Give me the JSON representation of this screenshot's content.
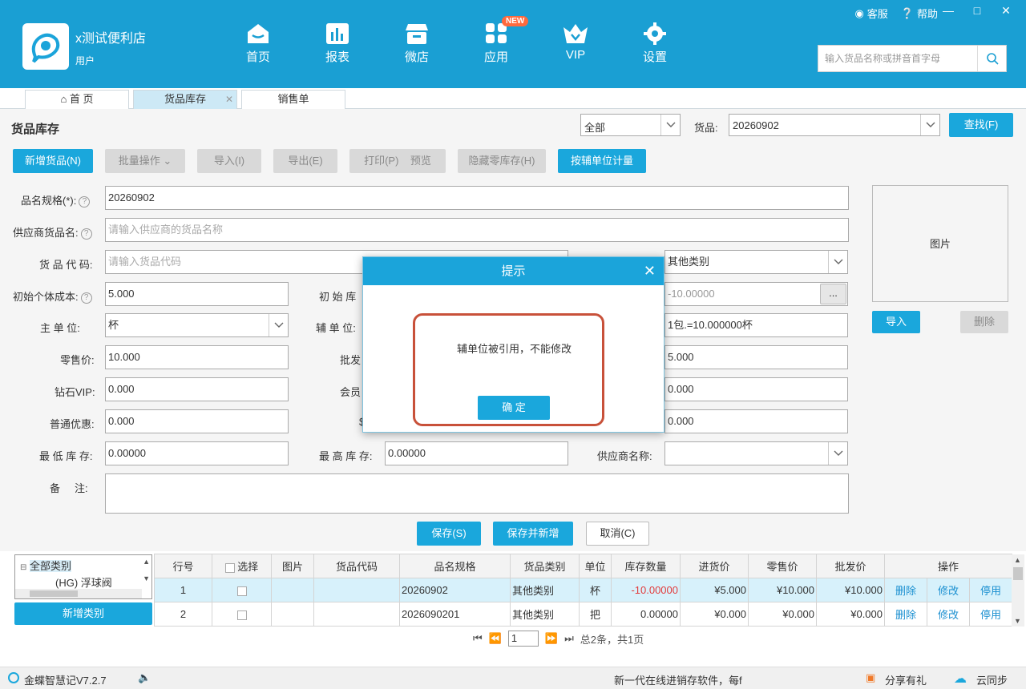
{
  "app": {
    "shop_name": "x测试便利店",
    "user": "用户",
    "version": "金蝶智慧记V7.2.7",
    "links": {
      "service": "客服",
      "help": "帮助"
    },
    "search_placeholder": "输入货品名称或拼音首字母"
  },
  "nav": {
    "home": "首页",
    "report": "报表",
    "shop": "微店",
    "apps": "应用",
    "apps_badge": "NEW",
    "vip": "VIP",
    "settings": "设置"
  },
  "tabs": {
    "home": "首 页",
    "inventory": "货品库存",
    "sales": "销售单"
  },
  "titlebar": {
    "title": "货品库存",
    "filter_value": "全部",
    "goods_label": "货品:",
    "goods_value": "20260902",
    "find_button": "查找(F)"
  },
  "toolbar": {
    "add_goods": "新增货品(N)",
    "batch": "批量操作",
    "import": "导入(I)",
    "export": "导出(E)",
    "print": "打印(P)",
    "preview": "预览",
    "hide_zero": "隐藏零库存(H)",
    "aux_unit": "按辅单位计量"
  },
  "form": {
    "name_label": "品名规格(*):",
    "name_value": "20260902",
    "supplier_goods_label": "供应商货品名:",
    "supplier_goods_placeholder": "请输入供应商的货品名称",
    "code_label": "货 品 代 码:",
    "code_placeholder": "请输入货品代码",
    "category_value": "其他类别",
    "init_cost_label": "初始个体成本:",
    "init_cost_value": "5.000",
    "init_stock_label": "初 始 库",
    "init_stock_value": "-10.00000",
    "more_button": "...",
    "main_unit_label": "主 单 位:",
    "main_unit_value": "杯",
    "aux_unit_label": "辅 单 位:",
    "aux_unit_value": "1包.=10.000000杯",
    "retail_label": "零售价:",
    "retail_value": "10.000",
    "wholesale_label": "批发",
    "wholesale_value": "5.000",
    "diamond_vip_label": "钻石VIP:",
    "diamond_vip_value": "0.000",
    "member_label": "会员",
    "member_value": "0.000",
    "normal_discount_label": "普通优惠:",
    "normal_discount_value": "0.000",
    "partial_label": "$",
    "right_value_3": "0.000",
    "min_stock_label": "最 低 库 存:",
    "min_stock_value": "0.00000",
    "max_stock_label": "最 高 库 存:",
    "max_stock_value": "0.00000",
    "supplier_name_label": "供应商名称:",
    "remark_label": "备     注:",
    "picture_label": "图片",
    "pic_import": "导入",
    "pic_delete": "删除",
    "save": "保存(S)",
    "save_new": "保存并新增",
    "cancel": "取消(C)"
  },
  "tree": {
    "root": "全部类别",
    "child": "(HG)  浮球阀",
    "add_category": "新增类别"
  },
  "grid": {
    "headers": [
      "行号",
      "选择",
      "图片",
      "货品代码",
      "品名规格",
      "货品类别",
      "单位",
      "库存数量",
      "进货价",
      "零售价",
      "批发价",
      "操作"
    ],
    "rows": [
      {
        "no": "1",
        "code": "",
        "name": "20260902",
        "category": "其他类别",
        "unit": "杯",
        "stock": "-10.00000",
        "purchase": "¥5.000",
        "retail": "¥10.000",
        "wholesale": "¥10.000"
      },
      {
        "no": "2",
        "code": "",
        "name": "2026090201",
        "category": "其他类别",
        "unit": "把",
        "stock": "0.00000",
        "purchase": "¥0.000",
        "retail": "¥0.000",
        "wholesale": "¥0.000"
      }
    ],
    "actions": {
      "delete": "删除",
      "edit": "修改",
      "disable": "停用"
    }
  },
  "pager": {
    "page": "1",
    "summary": "总2条，共1页"
  },
  "status": {
    "marquee": "新一代在线进销存软件，每f",
    "share": "分享有礼",
    "sync": "云同步"
  },
  "modal": {
    "title": "提示",
    "message": "辅单位被引用，不能修改",
    "ok": "确 定"
  },
  "colors": {
    "header": "#1a9fd3",
    "accent": "#1aa7dc",
    "negative": "#e23b3b",
    "highlight": "#c8513a"
  }
}
